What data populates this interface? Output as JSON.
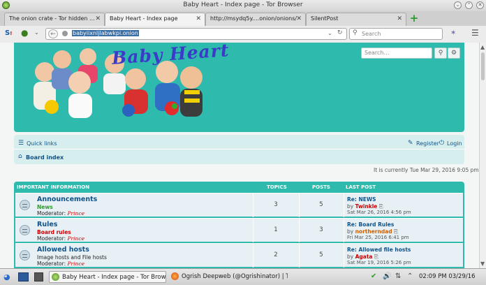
{
  "window": {
    "title": "Baby Heart - Index page - Tor Browser"
  },
  "tabs": [
    {
      "label": "The onion crate - Tor hidden ...",
      "active": false
    },
    {
      "label": "Baby Heart - Index page",
      "active": true
    },
    {
      "label": "http://msydq5y....onion/onions/",
      "active": false
    },
    {
      "label": "SilentPost",
      "active": false
    }
  ],
  "navbar": {
    "url": "babyiixnljlabwkpi.onion",
    "search_placeholder": "Search"
  },
  "forum_header": {
    "logo_text": "Baby Heart",
    "search_placeholder": "Search…"
  },
  "nav": {
    "quick_links": "Quick links",
    "register": "Register",
    "login": "Login",
    "board_index": "Board index"
  },
  "current_time": "It is currently Tue Mar 29, 2016 9:05 pm",
  "forum_table": {
    "section_title": "IMPORTANT INFORMATION",
    "col_topics": "TOPICS",
    "col_posts": "POSTS",
    "col_last_post": "LAST POST",
    "moderator_label": "Moderator:",
    "by_label": "by",
    "rows": [
      {
        "name": "Announcements",
        "desc": "News",
        "desc_color": "#2e9a2e",
        "moderator": "Prince",
        "topics": "3",
        "posts": "5",
        "last_title": "Re: NEWS",
        "last_user": "Twinkle",
        "last_user_color": "#a00000",
        "last_time": "Sat Mar 26, 2016 4:56 pm"
      },
      {
        "name": "Rules",
        "desc": "Board rules",
        "desc_color": "#d00000",
        "moderator": "Prince",
        "topics": "1",
        "posts": "3",
        "last_title": "Re: Board Rules",
        "last_user": "northerndad",
        "last_user_color": "#d06000",
        "last_time": "Fri Mar 25, 2016 6:41 pm"
      },
      {
        "name": "Allowed hosts",
        "desc": "Image hosts and File hosts",
        "desc_color": "#444444",
        "moderator": "Prince",
        "topics": "2",
        "posts": "5",
        "last_title": "Re: Allowed file hosts",
        "last_user": "Agata",
        "last_user_color": "#c00000",
        "last_time": "Sat Mar 19, 2016 5:26 pm"
      }
    ]
  },
  "taskbar": {
    "tasks": [
      {
        "label": "Baby Heart - Index page - Tor Browser",
        "active": true
      },
      {
        "label": "Ogrish Deepweb (@Ogrishinator) | Tw",
        "active": false
      }
    ],
    "clock": "02:09 PM 03/29/16"
  },
  "colors": {
    "teal": "#2fbaae",
    "link": "#105289",
    "light_teal": "#d7eeee"
  }
}
